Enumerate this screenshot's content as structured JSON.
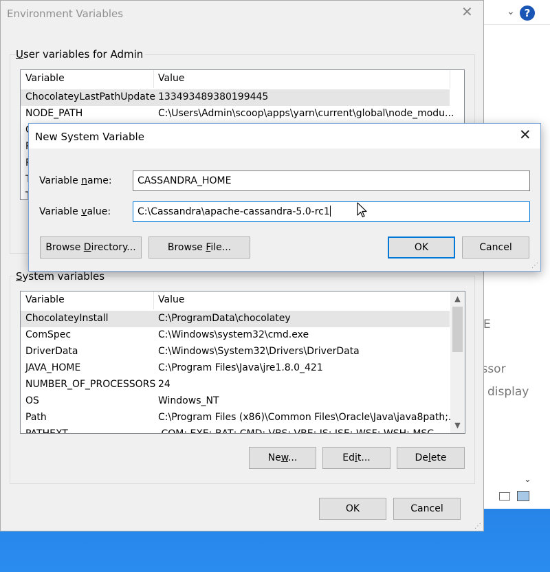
{
  "env_window": {
    "title": "Environment Variables",
    "user_group_label": "User variables for Admin",
    "system_group_label": "System variables",
    "columns": [
      "Variable",
      "Value"
    ],
    "user_rows": [
      {
        "name": "ChocolateyLastPathUpdate",
        "value": "133493489380199445"
      },
      {
        "name": "NODE_PATH",
        "value": "C:\\Users\\Admin\\scoop\\apps\\yarn\\current\\global\\node_modu..."
      }
    ],
    "user_hidden_initials": [
      "C",
      "P",
      "P",
      "T",
      "T"
    ],
    "system_rows": [
      {
        "name": "ChocolateyInstall",
        "value": "C:\\ProgramData\\chocolatey"
      },
      {
        "name": "ComSpec",
        "value": "C:\\Windows\\system32\\cmd.exe"
      },
      {
        "name": "DriverData",
        "value": "C:\\Windows\\System32\\Drivers\\DriverData"
      },
      {
        "name": "JAVA_HOME",
        "value": "C:\\Program Files\\Java\\jre1.8.0_421"
      },
      {
        "name": "NUMBER_OF_PROCESSORS",
        "value": "24"
      },
      {
        "name": "OS",
        "value": "Windows_NT"
      },
      {
        "name": "Path",
        "value": "C:\\Program Files (x86)\\Common Files\\Oracle\\Java\\java8path;..."
      },
      {
        "name": "PATHEXT",
        "value": ".COM;.EXE;.BAT;.CMD;.VBS;.VBE;.JS;.JSE;.WSF;.WSH;.MSC"
      }
    ],
    "system_buttons": {
      "new": "New...",
      "edit": "Edit...",
      "delete": "Delete"
    },
    "ok": "OK",
    "cancel": "Cancel"
  },
  "new_var_dialog": {
    "title": "New System Variable",
    "name_label": "Variable name:",
    "value_label": "Variable value:",
    "name_value": "CASSANDRA_HOME",
    "value_value": "C:\\Cassandra\\apache-cassandra-5.0-rc1",
    "browse_directory": "Browse Directory...",
    "browse_file": "Browse File...",
    "ok": "OK",
    "cancel": "Cancel"
  },
  "background_window": {
    "fragments": [
      "E",
      "essor",
      "display"
    ]
  }
}
